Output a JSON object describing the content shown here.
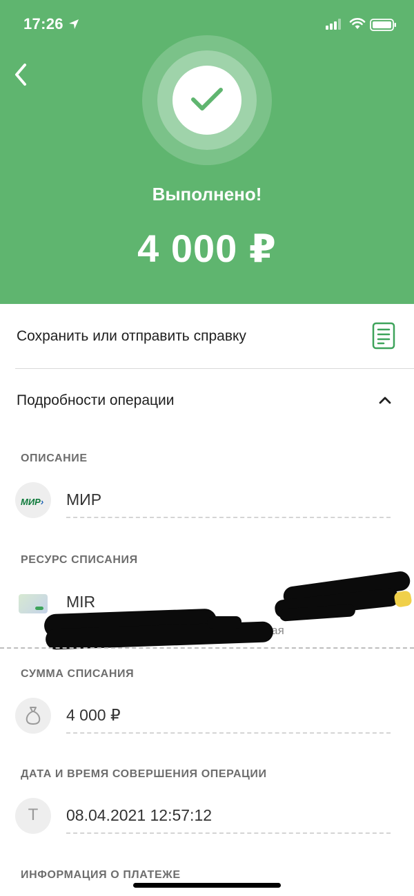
{
  "status_bar": {
    "time": "17:26"
  },
  "header": {
    "status_text": "Выполнено!",
    "amount": "4 000 ₽"
  },
  "receipt": {
    "label": "Сохранить или отправить справку"
  },
  "details": {
    "title": "Подробности операции",
    "description": {
      "label": "ОПИСАНИЕ",
      "logo_text": "МИР",
      "value": "МИР"
    },
    "resource": {
      "label": "РЕСУРС СПИСАНИЯ",
      "value": "MIR",
      "sub_text_partial": "…латная"
    },
    "sum": {
      "label": "СУММА СПИСАНИЯ",
      "value": "4 000 ₽"
    },
    "datetime": {
      "label": "ДАТА И ВРЕМЯ СОВЕРШЕНИЯ ОПЕРАЦИИ",
      "icon_letter": "Т",
      "value": "08.04.2021 12:57:12"
    },
    "payment_info": {
      "label": "ИНФОРМАЦИЯ О ПЛАТЕЖЕ"
    }
  },
  "colors": {
    "header_green": "#5fb56f",
    "accent_green": "#3da35a"
  }
}
